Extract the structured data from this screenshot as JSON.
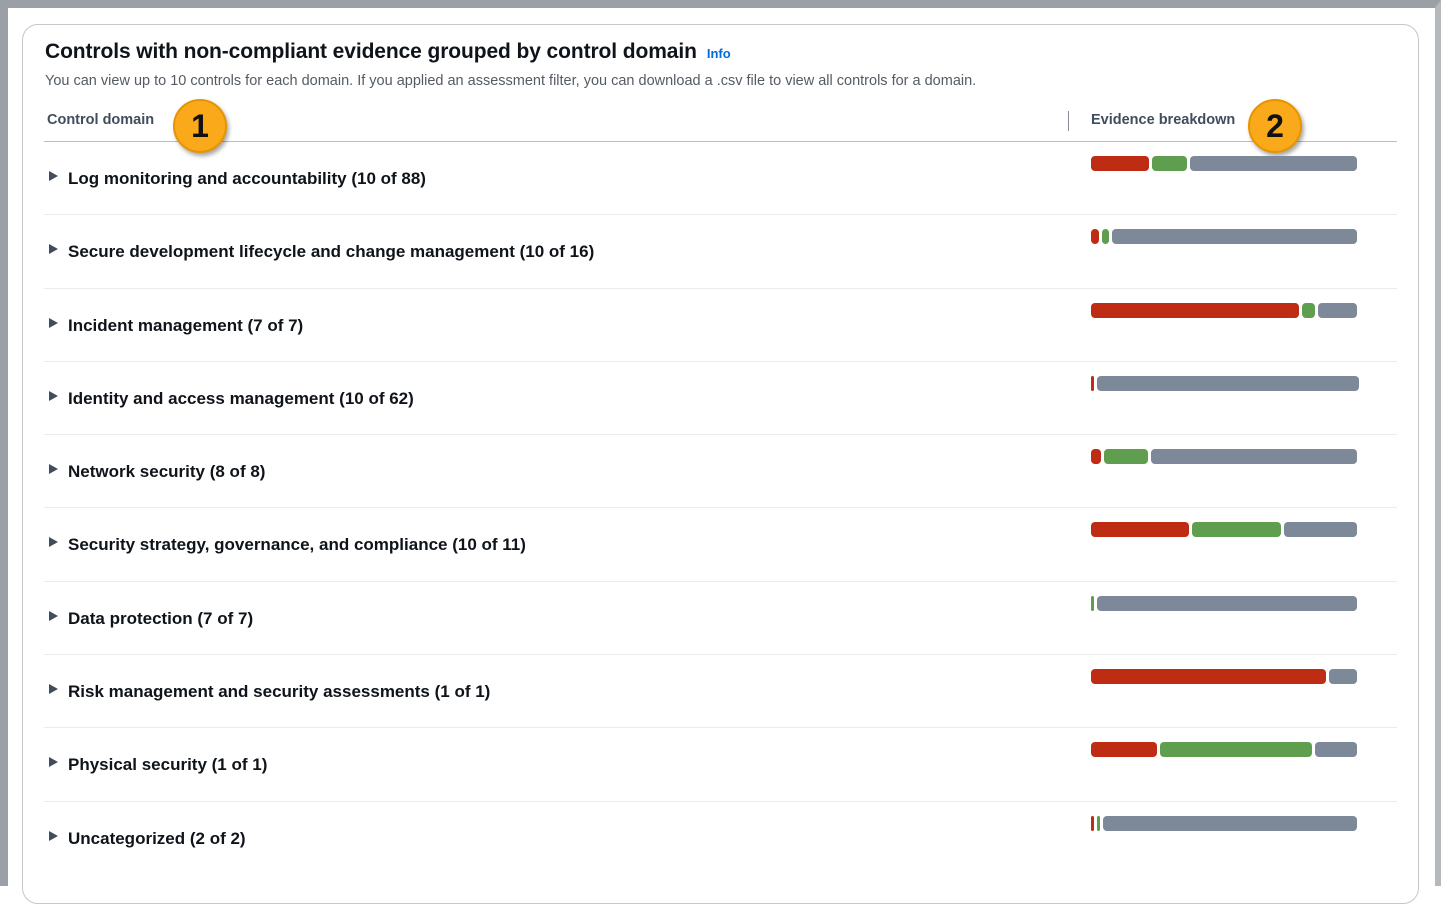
{
  "panel": {
    "title": "Controls with non-compliant evidence grouped by control domain",
    "info_label": "Info",
    "subtitle": "You can view up to 10 controls for each domain. If you applied an assessment filter, you can download a .csv file to view all controls for a domain."
  },
  "columns": {
    "domain": "Control domain",
    "evidence": "Evidence breakdown"
  },
  "callouts": [
    "1",
    "2"
  ],
  "colors": {
    "non_compliant": "#be2c13",
    "compliant": "#5f9e4f",
    "inconclusive": "#7d8998"
  },
  "rows": [
    {
      "label": "Log monitoring and accountability (10 of 88)",
      "breakdown": {
        "non_compliant": 58,
        "compliant": 34,
        "inconclusive": 166
      }
    },
    {
      "label": "Secure development lifecycle and change management (10 of 16)",
      "breakdown": {
        "non_compliant": 8,
        "compliant": 7,
        "inconclusive": 242
      }
    },
    {
      "label": "Incident management (7 of 7)",
      "breakdown": {
        "non_compliant": 206,
        "compliant": 13,
        "inconclusive": 39
      }
    },
    {
      "label": "Identity and access management (10 of 62)",
      "breakdown": {
        "non_compliant": 1,
        "compliant": 0,
        "inconclusive": 263
      }
    },
    {
      "label": "Network security (8 of 8)",
      "breakdown": {
        "non_compliant": 10,
        "compliant": 43,
        "inconclusive": 204
      }
    },
    {
      "label": "Security strategy, governance, and compliance (10 of 11)",
      "breakdown": {
        "non_compliant": 97,
        "compliant": 89,
        "inconclusive": 72
      }
    },
    {
      "label": "Data protection (7 of 7)",
      "breakdown": {
        "non_compliant": 0,
        "compliant": 3,
        "inconclusive": 259
      }
    },
    {
      "label": "Risk management and security assessments (1 of 1)",
      "breakdown": {
        "non_compliant": 232,
        "compliant": 0,
        "inconclusive": 28
      }
    },
    {
      "label": "Physical security (1 of 1)",
      "breakdown": {
        "non_compliant": 65,
        "compliant": 151,
        "inconclusive": 42
      }
    },
    {
      "label": "Uncategorized (2 of 2)",
      "breakdown": {
        "non_compliant": 3,
        "compliant": 3,
        "inconclusive": 257
      }
    }
  ]
}
